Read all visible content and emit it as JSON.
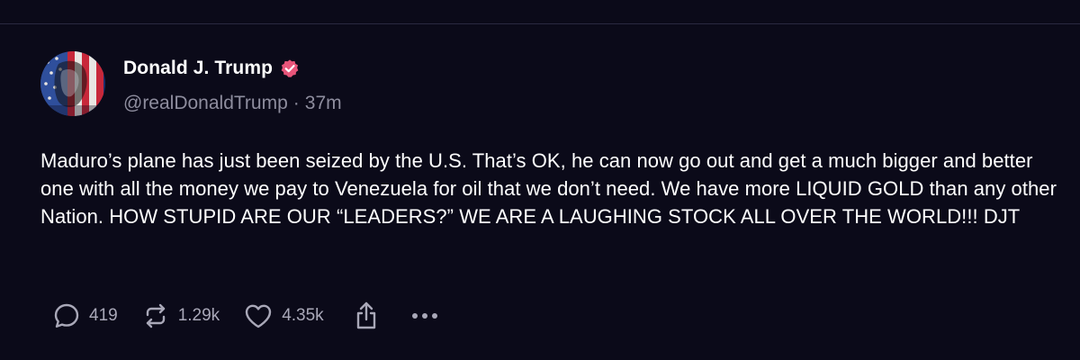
{
  "post": {
    "author": {
      "display_name": "Donald J. Trump",
      "handle": "@realDonaldTrump",
      "separator": "·",
      "time_ago": "37m",
      "verified": true
    },
    "text": "Maduro’s plane has just been seized by the U.S. That’s OK, he can now go out and get a much bigger and better one with all the money we pay to Venezuela for oil that we don’t need. We have more LIQUID GOLD than any other Nation. HOW STUPID ARE OUR “LEADERS?” WE ARE A LAUGHING STOCK ALL OVER THE WORLD!!! DJT",
    "actions": {
      "replies": "419",
      "reposts": "1.29k",
      "likes": "4.35k"
    }
  },
  "icons": {
    "reply": "speech-bubble-icon",
    "repost": "repost-arrows-icon",
    "like": "heart-icon",
    "share": "share-icon",
    "more": "more-dots-icon",
    "verified": "verified-badge-icon"
  },
  "colors": {
    "background": "#0b0a19",
    "verified_badge": "#e8557a",
    "muted_text": "#8e8d9e",
    "action_icons": "#a9a8b8"
  }
}
